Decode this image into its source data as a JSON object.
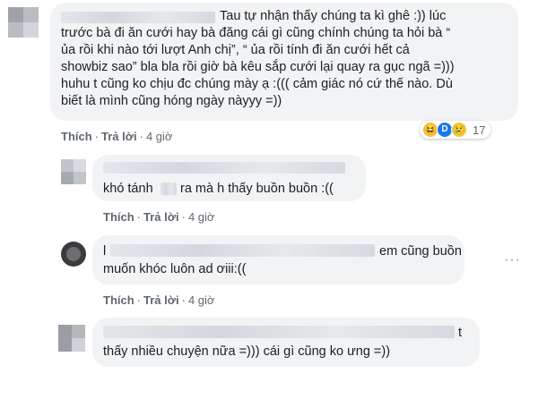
{
  "comments": [
    {
      "text_lines": [
        "Tau tự nhận thấy chúng ta kì ghê :)) lúc",
        "trước bà đi ăn cưới hay bà đăng cái gì cũng chính chúng ta hỏi bà “",
        "ủa rồi khi nào tới lượt Anh chị”, “ ủa rồi tính đi ăn cưới hết cả",
        "showbiz sao” bla bla rồi giờ bà kêu sắp cưới lại quay ra gục ngã =)))",
        "huhu t cũng ko chịu đc chúng mày ạ :((( cảm giác nó cứ thế nào. Dù",
        "biết là mình cũng hóng ngày nàyyy =))"
      ],
      "like_label": "Thích",
      "reply_label": "Trả lời",
      "time": "4 giờ",
      "reaction_count": "17"
    },
    {
      "text_lines": [
        "khó tánh",
        "ra mà h thấy buồn buồn :(("
      ],
      "like_label": "Thích",
      "reply_label": "Trả lời",
      "time": "4 giờ"
    },
    {
      "text_lines": [
        "em cũng buồn",
        "muốn khóc luôn ad ơiii:(("
      ],
      "like_label": "Thích",
      "reply_label": "Trả lời",
      "time": "4 giờ",
      "first_char": "l"
    },
    {
      "text_lines": [
        "t",
        "thấy nhiều chuyện nữa =))) cái gì cũng ko ưng =))"
      ]
    }
  ],
  "separator": "·",
  "more_options": "···"
}
